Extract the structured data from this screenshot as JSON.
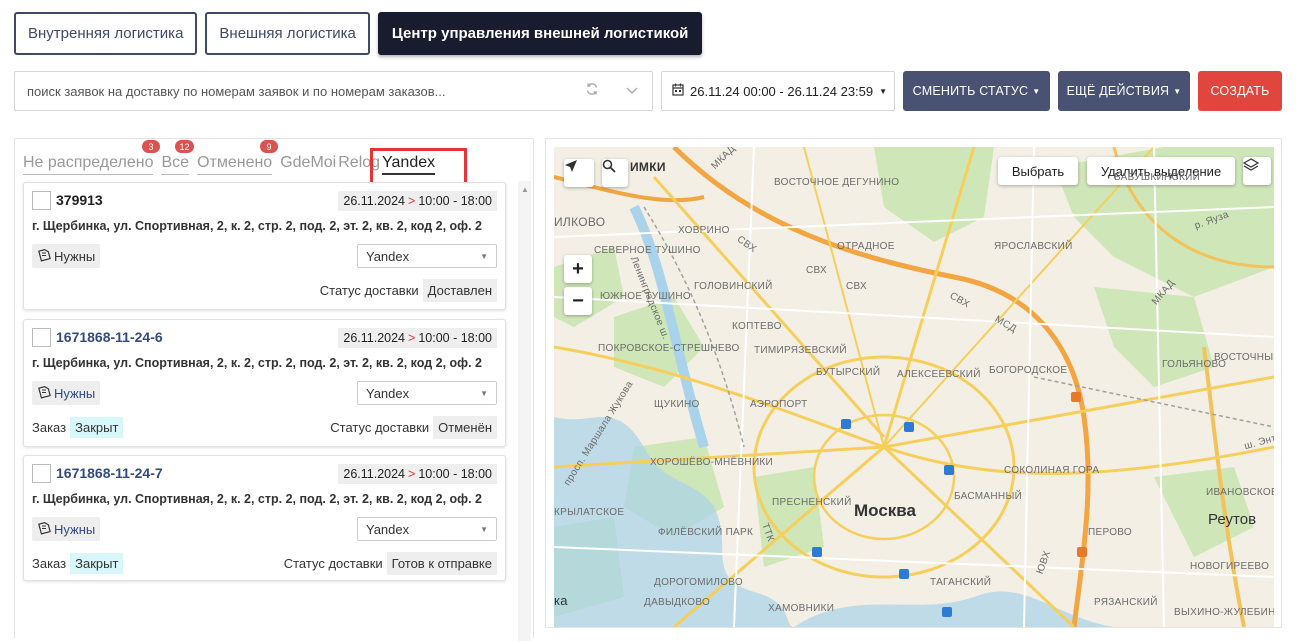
{
  "top_tabs": [
    {
      "label": "Внутренняя логистика"
    },
    {
      "label": "Внешняя логистика"
    },
    {
      "label": "Центр управления внешней логистикой"
    }
  ],
  "search": {
    "placeholder": "поиск заявок на доставку по номерам заявок и по номерам заказов..."
  },
  "date_range": "26.11.24 00:00 - 26.11.24 23:59",
  "buttons": {
    "change_status": "СМЕНИТЬ СТАТУС",
    "more_actions": "ЕЩЁ ДЕЙСТВИЯ",
    "create": "СОЗДАТЬ"
  },
  "status_tabs": [
    {
      "label": "Не распределено",
      "badge": "3"
    },
    {
      "label": "Все",
      "badge": "12"
    },
    {
      "label": "Отменено",
      "badge": "9"
    },
    {
      "label": "GdeMoi",
      "badge": ""
    },
    {
      "label": "Relog",
      "badge": ""
    },
    {
      "label": "Yandex",
      "badge": ""
    }
  ],
  "cards": [
    {
      "number": "379913",
      "date": "26.11.2024",
      "arrow": ">",
      "time": "10:00 - 18:00",
      "address": "г. Щербинка, ул. Спортивная, 2, к. 2, стр. 2, под. 2, эт. 2, кв. 2, код 2, оф. 2",
      "need": "Нужны",
      "carrier": "Yandex",
      "order_label": "",
      "order_status": "",
      "delivery_status_label": "Статус доставки",
      "delivery_status": "Доставлен"
    },
    {
      "number": "1671868-11-24-6",
      "date": "26.11.2024",
      "arrow": ">",
      "time": "10:00 - 18:00",
      "address": "г. Щербинка, ул. Спортивная, 2, к. 2, стр. 2, под. 2, эт. 2, кв. 2, код 2, оф. 2",
      "need": "Нужны",
      "carrier": "Yandex",
      "order_label": "Заказ",
      "order_status": "Закрыт",
      "delivery_status_label": "Статус доставки",
      "delivery_status": "Отменён"
    },
    {
      "number": "1671868-11-24-7",
      "date": "26.11.2024",
      "arrow": ">",
      "time": "10:00 - 18:00",
      "address": "г. Щербинка, ул. Спортивная, 2, к. 2, стр. 2, под. 2, эт. 2, кв. 2, код 2, оф. 2",
      "need": "Нужны",
      "carrier": "Yandex",
      "order_label": "Заказ",
      "order_status": "Закрыт",
      "delivery_status_label": "Статус доставки",
      "delivery_status": "Готов к отправке"
    }
  ],
  "map": {
    "select_button": "Выбрать",
    "clear_selection_button": "Удалить выделение",
    "zoom_in": "+",
    "zoom_out": "−",
    "labels": {
      "imki": "ИМКИ",
      "ilkovo": "ИЛКОВО",
      "mkad_top": "МКАД",
      "vostochnoe_degunino": "ВОСТОЧНОЕ ДЕГУНИНО",
      "severnoe_tushino": "СЕВЕРНОЕ ТУШИНО",
      "khovrino": "ХОВРИНО",
      "leningradskoe": "Ленинградское ш.",
      "otradnoe": "ОТРАДНОЕ",
      "babushkinsky": "БАБУШКИНСКИЙ",
      "yaroslavsky": "ЯРОСЛАВСКИЙ",
      "yauza": "р. Яуза",
      "mkad_right": "МКАД",
      "svh1": "СВХ",
      "svh2": "СВХ",
      "svh3": "СВХ",
      "svh4": "СВХ",
      "mtsd": "МСД",
      "golovinsky": "ГОЛОВИНСКИЙ",
      "koptevo": "КОПТЕВО",
      "yuzhnoe_tushino": "ЮЖНОЕ ТУШИНО",
      "timiryazevsky": "ТИМИРЯЗЕВСКИЙ",
      "pokrovskoe": "ПОКРОВСКОЕ-СТРЕШНЕВО",
      "butyrsky": "БУТЫРСКИЙ",
      "alekseevsky": "АЛЕКСЕЕВСКИЙ",
      "bogorodskoe": "БОГОРОДСКОЕ",
      "vostochny": "ВОСТОЧНЫЙ",
      "golyanovo": "ГОЛЬЯНОВО",
      "shchukino": "ЩУКИНО",
      "aeroport": "АЭРОПОРТ",
      "marshala": "просп. Маршала Жукова",
      "khoroshevo": "ХОРОШЁВО-МНЁВНИКИ",
      "sokolinaya": "СОКОЛИНАЯ ГОРА",
      "presnensky": "ПРЕСНЕНСКИЙ",
      "basmanny": "БАСМАННЫЙ",
      "moskva": "Москва",
      "reutov": "Реутов",
      "ivanovskoe": "ИВАНОВСКОЕ",
      "krylatskoe": "КРЫЛАТСКОЕ",
      "filevsky": "ФИЛЁВСКИЙ ПАРК",
      "perovo": "ПЕРОВО",
      "novogireevo": "НОВОГИРЕЕВО",
      "taganka": "ТАГАНСКИЙ",
      "dorogomilovo": "ДОРОГОМИЛОВО",
      "davydkovo": "ДАВЫДКОВО",
      "khamovniki": "ХАМОВНИКИ",
      "ryazansky": "РЯЗАНСКИЙ",
      "vykhino": "ВЫХИНО-ЖУЛЕБИНО",
      "ttk": "ТТК",
      "yuv": "ЮВХ",
      "ka": "ка",
      "sh_ent": "ш. Энт"
    }
  }
}
